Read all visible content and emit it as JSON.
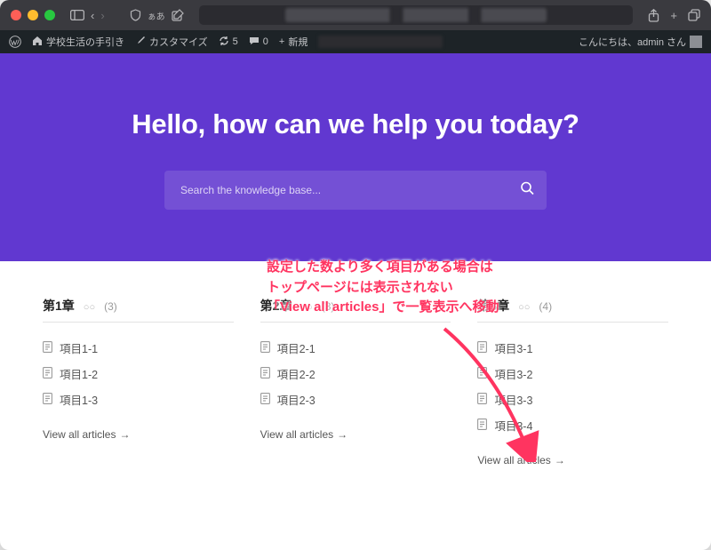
{
  "colors": {
    "accent": "#6138d0",
    "annotation": "#ff3460"
  },
  "mac_toolbar": {
    "share_icon": "share",
    "tabs_icon": "tabs"
  },
  "wp_bar": {
    "site_name": "学校生活の手引き",
    "customize": "カスタマイズ",
    "updates": "5",
    "comments": "0",
    "new": "新規",
    "greeting": "こんにちは、admin さん"
  },
  "hero": {
    "title": "Hello, how can we help you today?",
    "search_placeholder": "Search the knowledge base..."
  },
  "annotation": {
    "line1": "設定した数より多く項目がある場合は",
    "line2": "トップページには表示されない",
    "line3": "「View all articles」で一覧表示へ移動"
  },
  "columns": [
    {
      "title": "第1章",
      "sub": "○○",
      "count": "(3)",
      "items": [
        "項目1-1",
        "項目1-2",
        "項目1-3"
      ],
      "view_all": "View all articles"
    },
    {
      "title": "第2章",
      "sub": "○○",
      "count": "(3)",
      "items": [
        "項目2-1",
        "項目2-2",
        "項目2-3"
      ],
      "view_all": "View all articles"
    },
    {
      "title": "第3章",
      "sub": "○○",
      "count": "(4)",
      "items": [
        "項目3-1",
        "項目3-2",
        "項目3-3",
        "項目3-4"
      ],
      "view_all": "View all articles"
    }
  ]
}
